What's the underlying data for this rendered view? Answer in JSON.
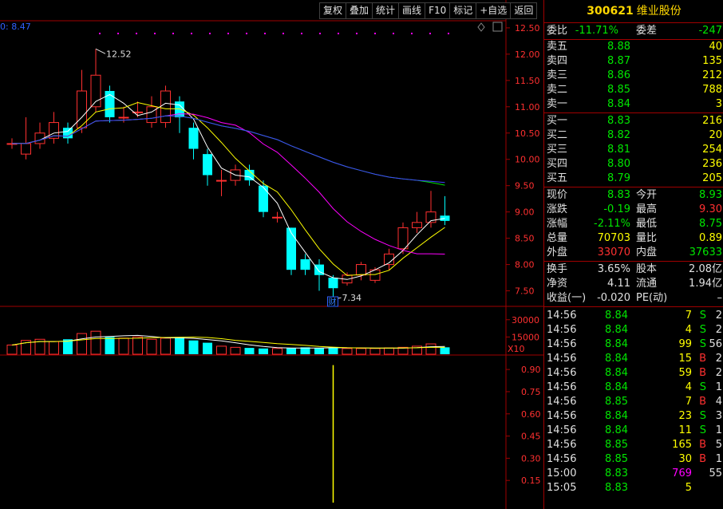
{
  "toolbar": [
    "复权",
    "叠加",
    "统计",
    "画线",
    "F10",
    "标记",
    "+自选",
    "返回"
  ],
  "stock": {
    "code": "300621",
    "name": "维业股份"
  },
  "ma_label": "0: 8.47",
  "xlabel": "X10",
  "cai_label": "财",
  "weibi": {
    "l1": "委比",
    "v1": "-11.71%",
    "l2": "委差",
    "v2": "-247"
  },
  "asks": [
    {
      "label": "卖五",
      "price": "8.88",
      "vol": "40"
    },
    {
      "label": "卖四",
      "price": "8.87",
      "vol": "135"
    },
    {
      "label": "卖三",
      "price": "8.86",
      "vol": "212"
    },
    {
      "label": "卖二",
      "price": "8.85",
      "vol": "788"
    },
    {
      "label": "卖一",
      "price": "8.84",
      "vol": "3"
    }
  ],
  "bids": [
    {
      "label": "买一",
      "price": "8.83",
      "vol": "216"
    },
    {
      "label": "买二",
      "price": "8.82",
      "vol": "20"
    },
    {
      "label": "买三",
      "price": "8.81",
      "vol": "254"
    },
    {
      "label": "买四",
      "price": "8.80",
      "vol": "236"
    },
    {
      "label": "买五",
      "price": "8.79",
      "vol": "205"
    }
  ],
  "quote": [
    {
      "l1": "现价",
      "v1": "8.83",
      "c1": "green",
      "l2": "今开",
      "v2": "8.93",
      "c2": "green"
    },
    {
      "l1": "涨跌",
      "v1": "-0.19",
      "c1": "green",
      "l2": "最高",
      "v2": "9.30",
      "c2": "red"
    },
    {
      "l1": "涨幅",
      "v1": "-2.11%",
      "c1": "green",
      "l2": "最低",
      "v2": "8.75",
      "c2": "green"
    },
    {
      "l1": "总量",
      "v1": "70703",
      "c1": "yellow",
      "l2": "量比",
      "v2": "0.89",
      "c2": "yellow"
    },
    {
      "l1": "外盘",
      "v1": "33070",
      "c1": "red",
      "l2": "内盘",
      "v2": "37633",
      "c2": "green"
    }
  ],
  "stats": [
    {
      "l1": "换手",
      "v1": "3.65%",
      "l2": "股本",
      "v2": "2.08亿"
    },
    {
      "l1": "净资",
      "v1": "4.11",
      "l2": "流通",
      "v2": "1.94亿"
    },
    {
      "l1": "收益(一)",
      "v1": "-0.020",
      "l2": "PE(动)",
      "v2": "–"
    }
  ],
  "trades": [
    {
      "t": "14:56",
      "p": "8.84",
      "pc": "green",
      "v": "7",
      "vc": "yellow",
      "d": "S",
      "dc": "green",
      "n": "2"
    },
    {
      "t": "14:56",
      "p": "8.84",
      "pc": "green",
      "v": "4",
      "vc": "yellow",
      "d": "S",
      "dc": "green",
      "n": "2"
    },
    {
      "t": "14:56",
      "p": "8.84",
      "pc": "green",
      "v": "99",
      "vc": "yellow",
      "d": "S",
      "dc": "green",
      "n": "56"
    },
    {
      "t": "14:56",
      "p": "8.84",
      "pc": "green",
      "v": "15",
      "vc": "yellow",
      "d": "B",
      "dc": "red",
      "n": "2"
    },
    {
      "t": "14:56",
      "p": "8.84",
      "pc": "green",
      "v": "59",
      "vc": "yellow",
      "d": "B",
      "dc": "red",
      "n": "2"
    },
    {
      "t": "14:56",
      "p": "8.84",
      "pc": "green",
      "v": "4",
      "vc": "yellow",
      "d": "S",
      "dc": "green",
      "n": "1"
    },
    {
      "t": "14:56",
      "p": "8.85",
      "pc": "green",
      "v": "7",
      "vc": "yellow",
      "d": "B",
      "dc": "red",
      "n": "4"
    },
    {
      "t": "14:56",
      "p": "8.84",
      "pc": "green",
      "v": "23",
      "vc": "yellow",
      "d": "S",
      "dc": "green",
      "n": "3"
    },
    {
      "t": "14:56",
      "p": "8.84",
      "pc": "green",
      "v": "11",
      "vc": "yellow",
      "d": "S",
      "dc": "green",
      "n": "1"
    },
    {
      "t": "14:56",
      "p": "8.85",
      "pc": "green",
      "v": "165",
      "vc": "yellow",
      "d": "B",
      "dc": "red",
      "n": "5"
    },
    {
      "t": "14:56",
      "p": "8.85",
      "pc": "green",
      "v": "30",
      "vc": "yellow",
      "d": "B",
      "dc": "red",
      "n": "1"
    },
    {
      "t": "15:00",
      "p": "8.83",
      "pc": "green",
      "v": "769",
      "vc": "magenta",
      "d": "",
      "dc": "green",
      "n": "55"
    },
    {
      "t": "15:05",
      "p": "8.83",
      "pc": "green",
      "v": "5",
      "vc": "yellow",
      "d": "",
      "dc": "green",
      "n": ""
    }
  ],
  "chart_data": {
    "type": "candlestick",
    "price_ticks": [
      "12.50",
      "12.00",
      "11.50",
      "11.00",
      "10.50",
      "10.00",
      "9.50",
      "9.00",
      "8.50",
      "8.00",
      "7.50"
    ],
    "vol_ticks": [
      "30000",
      "15000"
    ],
    "ind_ticks": [
      "0.90",
      "0.75",
      "0.60",
      "0.45",
      "0.30",
      "0.15"
    ],
    "high_label": "12.52",
    "low_label": "7.34",
    "candles": [
      {
        "o": 10.3,
        "c": 10.3,
        "h": 10.4,
        "l": 10.2
      },
      {
        "o": 10.1,
        "c": 10.3,
        "h": 10.8,
        "l": 10.0
      },
      {
        "o": 10.3,
        "c": 10.5,
        "h": 10.7,
        "l": 10.2
      },
      {
        "o": 10.4,
        "c": 10.7,
        "h": 10.9,
        "l": 10.3
      },
      {
        "o": 10.6,
        "c": 10.4,
        "h": 10.7,
        "l": 10.3
      },
      {
        "o": 10.6,
        "c": 11.3,
        "h": 11.7,
        "l": 10.5
      },
      {
        "o": 11.0,
        "c": 11.6,
        "h": 12.1,
        "l": 10.9
      },
      {
        "o": 11.3,
        "c": 10.8,
        "h": 11.4,
        "l": 10.7
      },
      {
        "o": 10.8,
        "c": 10.8,
        "h": 11.0,
        "l": 10.7
      },
      {
        "o": 10.9,
        "c": 10.9,
        "h": 11.1,
        "l": 10.8
      },
      {
        "o": 10.7,
        "c": 11.0,
        "h": 11.2,
        "l": 10.6
      },
      {
        "o": 10.7,
        "c": 11.3,
        "h": 11.4,
        "l": 10.6
      },
      {
        "o": 11.1,
        "c": 10.8,
        "h": 11.2,
        "l": 10.5
      },
      {
        "o": 10.6,
        "c": 10.2,
        "h": 10.7,
        "l": 10.0
      },
      {
        "o": 10.1,
        "c": 9.7,
        "h": 10.2,
        "l": 9.5
      },
      {
        "o": 9.6,
        "c": 9.6,
        "h": 9.8,
        "l": 9.3
      },
      {
        "o": 9.6,
        "c": 9.8,
        "h": 9.9,
        "l": 9.5
      },
      {
        "o": 9.8,
        "c": 9.6,
        "h": 9.9,
        "l": 9.5
      },
      {
        "o": 9.5,
        "c": 9.0,
        "h": 9.6,
        "l": 8.9
      },
      {
        "o": 8.9,
        "c": 8.9,
        "h": 9.0,
        "l": 8.8
      },
      {
        "o": 8.7,
        "c": 7.9,
        "h": 8.7,
        "l": 7.8
      },
      {
        "o": 8.1,
        "c": 7.9,
        "h": 8.2,
        "l": 7.8
      },
      {
        "o": 8.0,
        "c": 7.8,
        "h": 8.1,
        "l": 7.5
      },
      {
        "o": 7.75,
        "c": 7.55,
        "h": 7.8,
        "l": 7.34
      },
      {
        "o": 7.65,
        "c": 7.8,
        "h": 7.85,
        "l": 7.6
      },
      {
        "o": 7.8,
        "c": 8.0,
        "h": 8.05,
        "l": 7.7
      },
      {
        "o": 7.7,
        "c": 7.9,
        "h": 7.95,
        "l": 7.65
      },
      {
        "o": 8.0,
        "c": 8.2,
        "h": 8.3,
        "l": 7.9
      },
      {
        "o": 8.3,
        "c": 8.7,
        "h": 8.8,
        "l": 8.2
      },
      {
        "o": 8.7,
        "c": 8.8,
        "h": 9.0,
        "l": 8.6
      },
      {
        "o": 8.8,
        "c": 9.0,
        "h": 9.4,
        "l": 8.7
      },
      {
        "o": 8.93,
        "c": 8.83,
        "h": 9.3,
        "l": 8.75
      }
    ],
    "volumes": [
      8000,
      12000,
      13000,
      11000,
      13000,
      18000,
      20000,
      15000,
      14000,
      15000,
      13000,
      14000,
      15000,
      12000,
      10000,
      7000,
      6000,
      5500,
      5000,
      5000,
      5500,
      6000,
      5500,
      6000,
      5000,
      5000,
      5000,
      5500,
      6000,
      7000,
      9000,
      6000
    ]
  }
}
